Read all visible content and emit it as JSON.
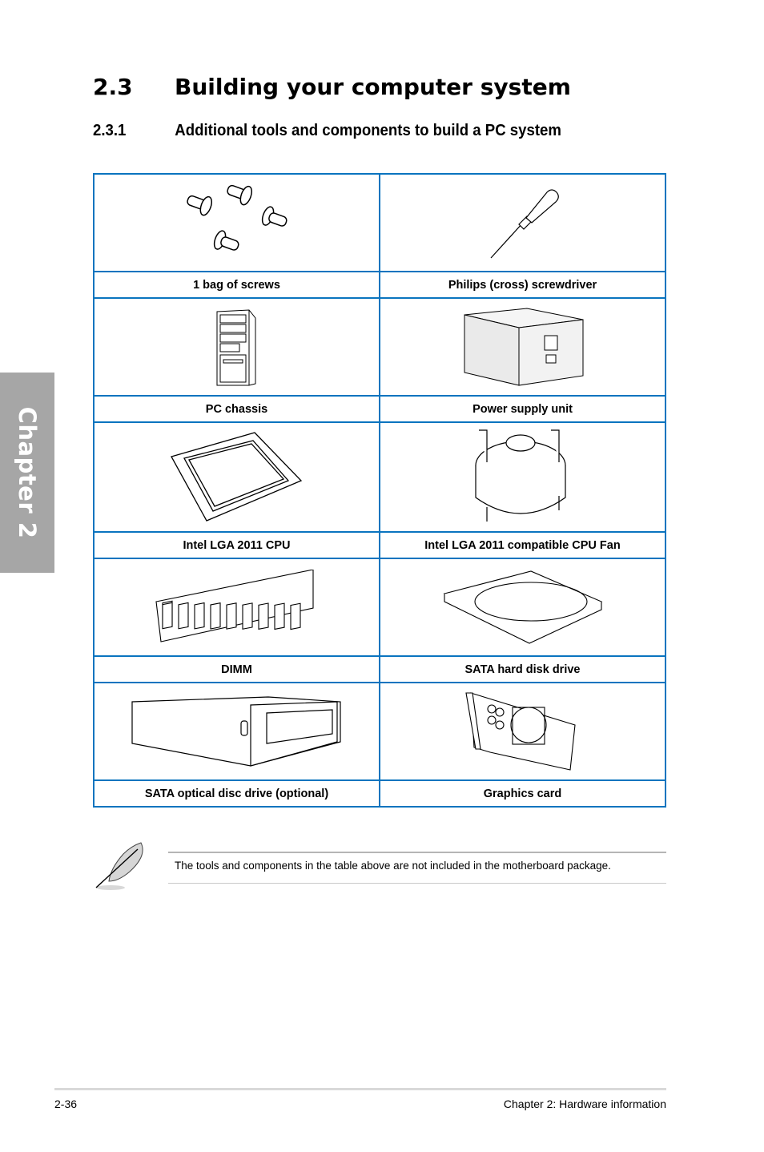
{
  "chapter_tab": "Chapter 2",
  "section": {
    "number": "2.3",
    "title": "Building your computer system"
  },
  "subsection": {
    "number": "2.3.1",
    "title": "Additional tools and components to build a PC system"
  },
  "items_table": {
    "rows": [
      [
        {
          "label": "1 bag of screws",
          "icon": "screws-icon"
        },
        {
          "label": "Philips (cross) screwdriver",
          "icon": "screwdriver-icon"
        }
      ],
      [
        {
          "label": "PC chassis",
          "icon": "pc-chassis-icon"
        },
        {
          "label": "Power supply unit",
          "icon": "power-supply-icon"
        }
      ],
      [
        {
          "label": "Intel LGA 2011 CPU",
          "icon": "cpu-icon"
        },
        {
          "label": "Intel LGA 2011 compatible CPU Fan",
          "icon": "cpu-fan-icon"
        }
      ],
      [
        {
          "label": "DIMM",
          "icon": "dimm-icon"
        },
        {
          "label": "SATA hard disk drive",
          "icon": "hard-disk-icon"
        }
      ],
      [
        {
          "label": "SATA optical disc drive (optional)",
          "icon": "optical-drive-icon"
        },
        {
          "label": "Graphics card",
          "icon": "graphics-card-icon"
        }
      ]
    ]
  },
  "note": {
    "icon": "feather-note-icon",
    "text": "The tools and components in the table above are not included in the motherboard package."
  },
  "footer": {
    "page_number": "2-36",
    "chapter_title": "Chapter 2: Hardware information"
  },
  "colors": {
    "table_border": "#0a74bf",
    "chapter_tab": "#a6a6a6"
  }
}
